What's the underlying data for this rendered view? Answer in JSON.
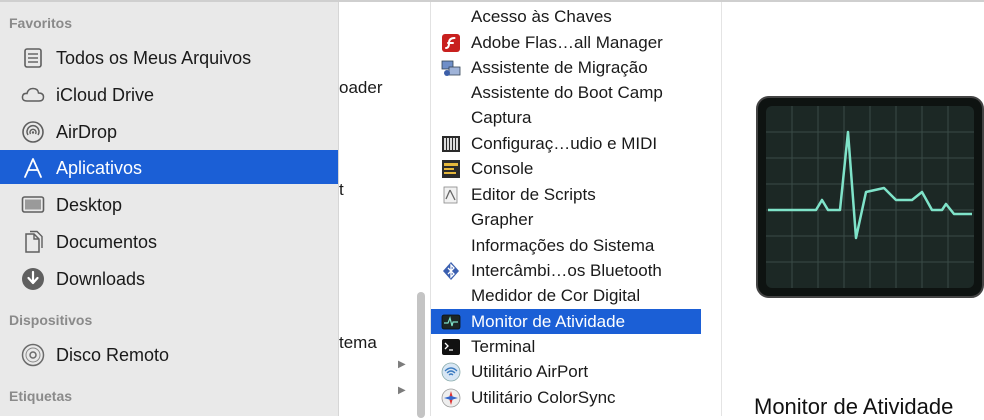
{
  "sidebar": {
    "sections": {
      "favorites": "Favoritos",
      "devices": "Dispositivos",
      "tags": "Etiquetas"
    },
    "items": [
      {
        "label": "Todos os Meus Arquivos",
        "icon": "all-files-icon"
      },
      {
        "label": "iCloud Drive",
        "icon": "cloud-icon"
      },
      {
        "label": "AirDrop",
        "icon": "airdrop-icon"
      },
      {
        "label": "Aplicativos",
        "icon": "applications-icon",
        "selected": true
      },
      {
        "label": "Desktop",
        "icon": "desktop-icon"
      },
      {
        "label": "Documentos",
        "icon": "documents-icon"
      },
      {
        "label": "Downloads",
        "icon": "downloads-icon"
      }
    ],
    "devices": [
      {
        "label": "Disco Remoto",
        "icon": "disc-icon"
      }
    ]
  },
  "column1": {
    "fragments": [
      "oader",
      "t",
      "tema"
    ]
  },
  "list": {
    "items": [
      {
        "label": "Acesso às Chaves",
        "icon": "keychain-icon"
      },
      {
        "label": "Adobe Flas…all Manager",
        "icon": "flash-icon"
      },
      {
        "label": "Assistente de Migração",
        "icon": "migration-icon"
      },
      {
        "label": "Assistente do Boot Camp",
        "icon": "bootcamp-icon"
      },
      {
        "label": "Captura",
        "icon": "grab-icon"
      },
      {
        "label": "Configuraç…udio e MIDI",
        "icon": "midi-icon"
      },
      {
        "label": "Console",
        "icon": "console-icon"
      },
      {
        "label": "Editor de Scripts",
        "icon": "script-editor-icon"
      },
      {
        "label": "Grapher",
        "icon": "grapher-icon"
      },
      {
        "label": "Informações do Sistema",
        "icon": "system-info-icon"
      },
      {
        "label": "Intercâmbi…os Bluetooth",
        "icon": "bluetooth-icon"
      },
      {
        "label": "Medidor de Cor Digital",
        "icon": "color-meter-icon"
      },
      {
        "label": "Monitor de Atividade",
        "icon": "activity-monitor-icon",
        "selected": true
      },
      {
        "label": "Terminal",
        "icon": "terminal-icon"
      },
      {
        "label": "Utilitário AirPort",
        "icon": "airport-icon"
      },
      {
        "label": "Utilitário ColorSync",
        "icon": "colorsync-icon"
      }
    ]
  },
  "preview": {
    "title": "Monitor de Atividade",
    "icon": "activity-monitor-large-icon"
  },
  "colors": {
    "selection": "#1b5fd6",
    "sidebar_bg": "#e9e9e9",
    "section_text": "#8a8a8a",
    "monitor_line": "#7fe3c9"
  }
}
